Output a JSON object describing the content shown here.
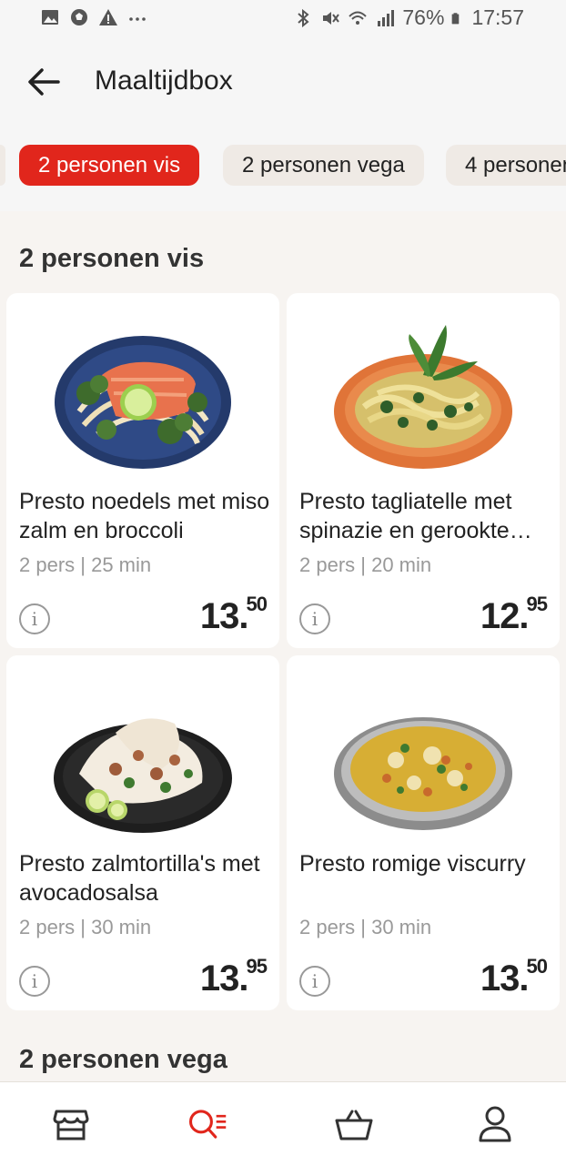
{
  "status_bar": {
    "battery": "76%",
    "time": "17:57",
    "left_icons": [
      "image-icon",
      "soccer-ball-icon",
      "warning-icon",
      "more-icon"
    ],
    "right_icons": [
      "bluetooth-icon",
      "mute-icon",
      "wifi-icon",
      "signal-icon",
      "battery-icon"
    ]
  },
  "header": {
    "title": "Maaltijdbox"
  },
  "chips": [
    {
      "label": "2 personen vis",
      "active": true
    },
    {
      "label": "2 personen vega",
      "active": false
    },
    {
      "label": "4 personen",
      "active": false
    }
  ],
  "sections": [
    {
      "title": "2 personen vis",
      "products": [
        {
          "name": "Presto noedels met miso zalm en broccoli",
          "meta": "2 pers | 25 min",
          "price_main": "13",
          "price_cents": "50",
          "plate": "noodles"
        },
        {
          "name": "Presto tagliatelle met spinazie en gerookte…",
          "meta": "2 pers | 20 min",
          "price_main": "12",
          "price_cents": "95",
          "plate": "tagliatelle"
        },
        {
          "name": "Presto zalmtortilla's met avocadosalsa",
          "meta": "2 pers | 30 min",
          "price_main": "13",
          "price_cents": "95",
          "plate": "tortilla"
        },
        {
          "name": "Presto romige viscurry",
          "meta": "2 pers | 30 min",
          "price_main": "13",
          "price_cents": "50",
          "plate": "curry"
        }
      ]
    },
    {
      "title": "2 personen vega"
    }
  ],
  "bottom_nav": [
    {
      "icon": "store-icon",
      "active": false
    },
    {
      "icon": "search-list-icon",
      "active": true
    },
    {
      "icon": "basket-icon",
      "active": false
    },
    {
      "icon": "profile-icon",
      "active": false
    }
  ],
  "colors": {
    "accent": "#e1261c",
    "background": "#f7f4f1",
    "card": "#ffffff",
    "text": "#222222",
    "muted": "#999999"
  }
}
